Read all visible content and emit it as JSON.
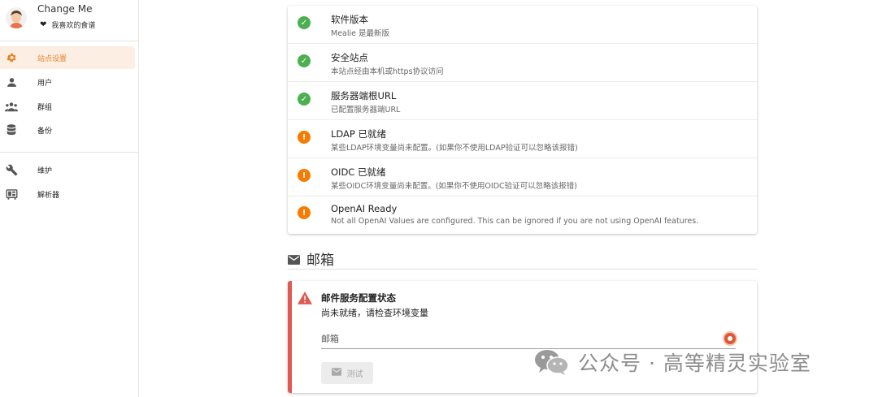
{
  "profile": {
    "name": "Change Me",
    "favorites_label": "我喜欢的食谱"
  },
  "sidebar": {
    "items": [
      {
        "label": "站点设置",
        "icon": "gear-icon",
        "active": true
      },
      {
        "label": "用户",
        "icon": "person-icon",
        "active": false
      },
      {
        "label": "群组",
        "icon": "group-icon",
        "active": false
      },
      {
        "label": "备份",
        "icon": "database-icon",
        "active": false
      },
      {
        "label": "维护",
        "icon": "wrench-icon",
        "active": false
      },
      {
        "label": "解析器",
        "icon": "parser-icon",
        "active": false
      }
    ]
  },
  "checks": [
    {
      "title": "软件版本",
      "subtitle": "Mealie 是最新版",
      "status": "ok"
    },
    {
      "title": "安全站点",
      "subtitle": "本站点经由本机或https协议访问",
      "status": "ok"
    },
    {
      "title": "服务器端根URL",
      "subtitle": "已配置服务器端URL",
      "status": "ok"
    },
    {
      "title": "LDAP 已就绪",
      "subtitle": "某些LDAP环境变量尚未配置。(如果你不使用LDAP验证可以忽略该报错)",
      "status": "warn"
    },
    {
      "title": "OIDC 已就绪",
      "subtitle": "某些OIDC环境变量尚未配置。(如果你不使用OIDC验证可以忽略该报错)",
      "status": "warn"
    },
    {
      "title": "OpenAI Ready",
      "subtitle": "Not all OpenAI Values are configured. This can be ignored if you are not using OpenAI features.",
      "status": "warn"
    }
  ],
  "email_section": {
    "title": "邮箱",
    "alert_title": "邮件服务配置状态",
    "alert_subtitle": "尚未就绪，请检查环境变量",
    "email_placeholder": "邮箱",
    "test_button_label": "测试"
  },
  "watermark": {
    "text": "公众号 · 高等精灵实验室"
  },
  "colors": {
    "accent": "#e58325",
    "ok": "#4caf50",
    "warn": "#f57c00",
    "error": "#e05a52"
  }
}
